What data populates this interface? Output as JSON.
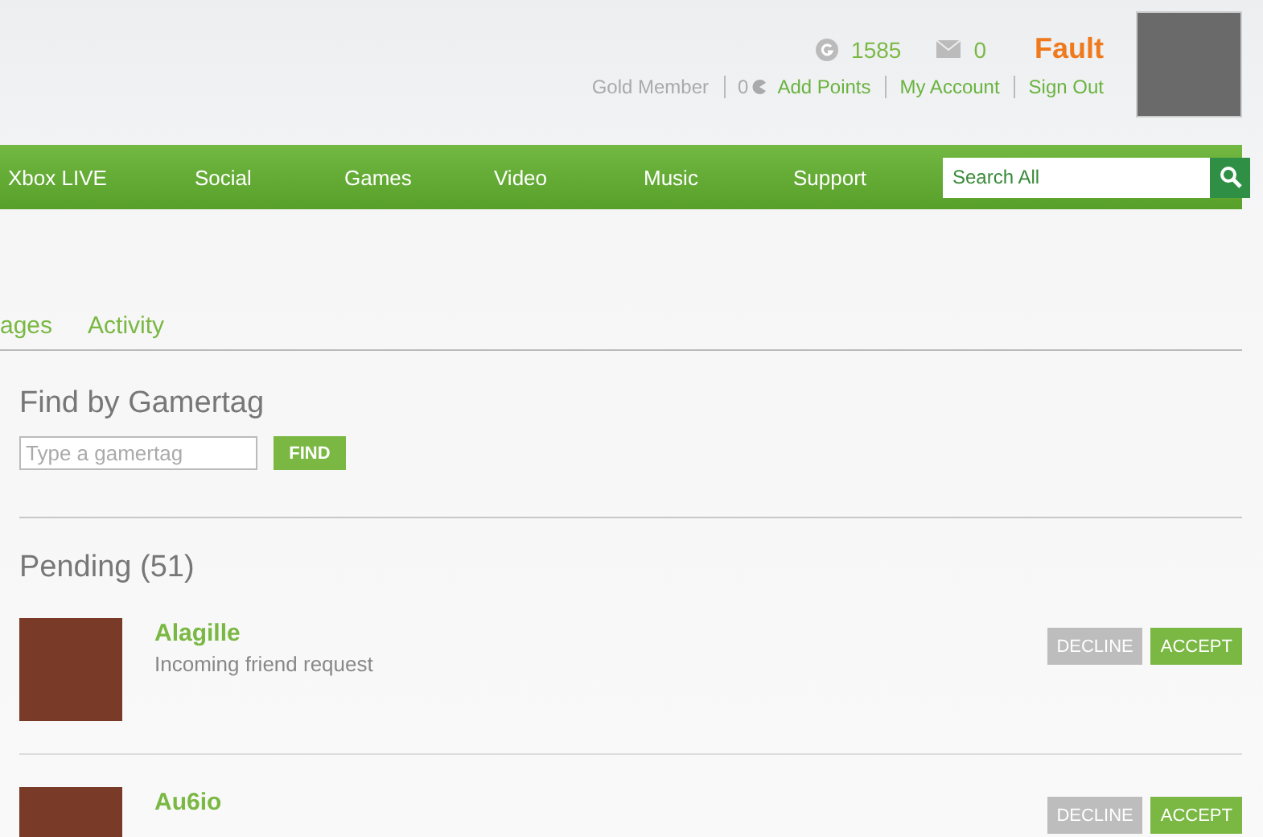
{
  "account": {
    "gamerscore": "1585",
    "messages": "0",
    "gamertag": "Fault",
    "membership": "Gold Member",
    "points": "0",
    "links": [
      "Add Points",
      "My Account",
      "Sign Out"
    ]
  },
  "nav": {
    "items": [
      "Xbox LIVE",
      "Social",
      "Games",
      "Video",
      "Music",
      "Support"
    ],
    "search": {
      "placeholder": "Search All"
    }
  },
  "tabs": [
    {
      "label": "ages",
      "selected": false
    },
    {
      "label": "Activity",
      "selected": false
    }
  ],
  "find": {
    "title": "Find by Gamertag",
    "placeholder": "Type a gamertag",
    "button": "FIND"
  },
  "pending": {
    "title": "Pending (51)",
    "requests": [
      {
        "gamertag": "Alagille",
        "message": "Incoming friend request",
        "decline": "DECLINE",
        "accept": "ACCEPT"
      },
      {
        "gamertag": "Au6io",
        "decline": "DECLINE",
        "accept": "ACCEPT"
      }
    ]
  }
}
